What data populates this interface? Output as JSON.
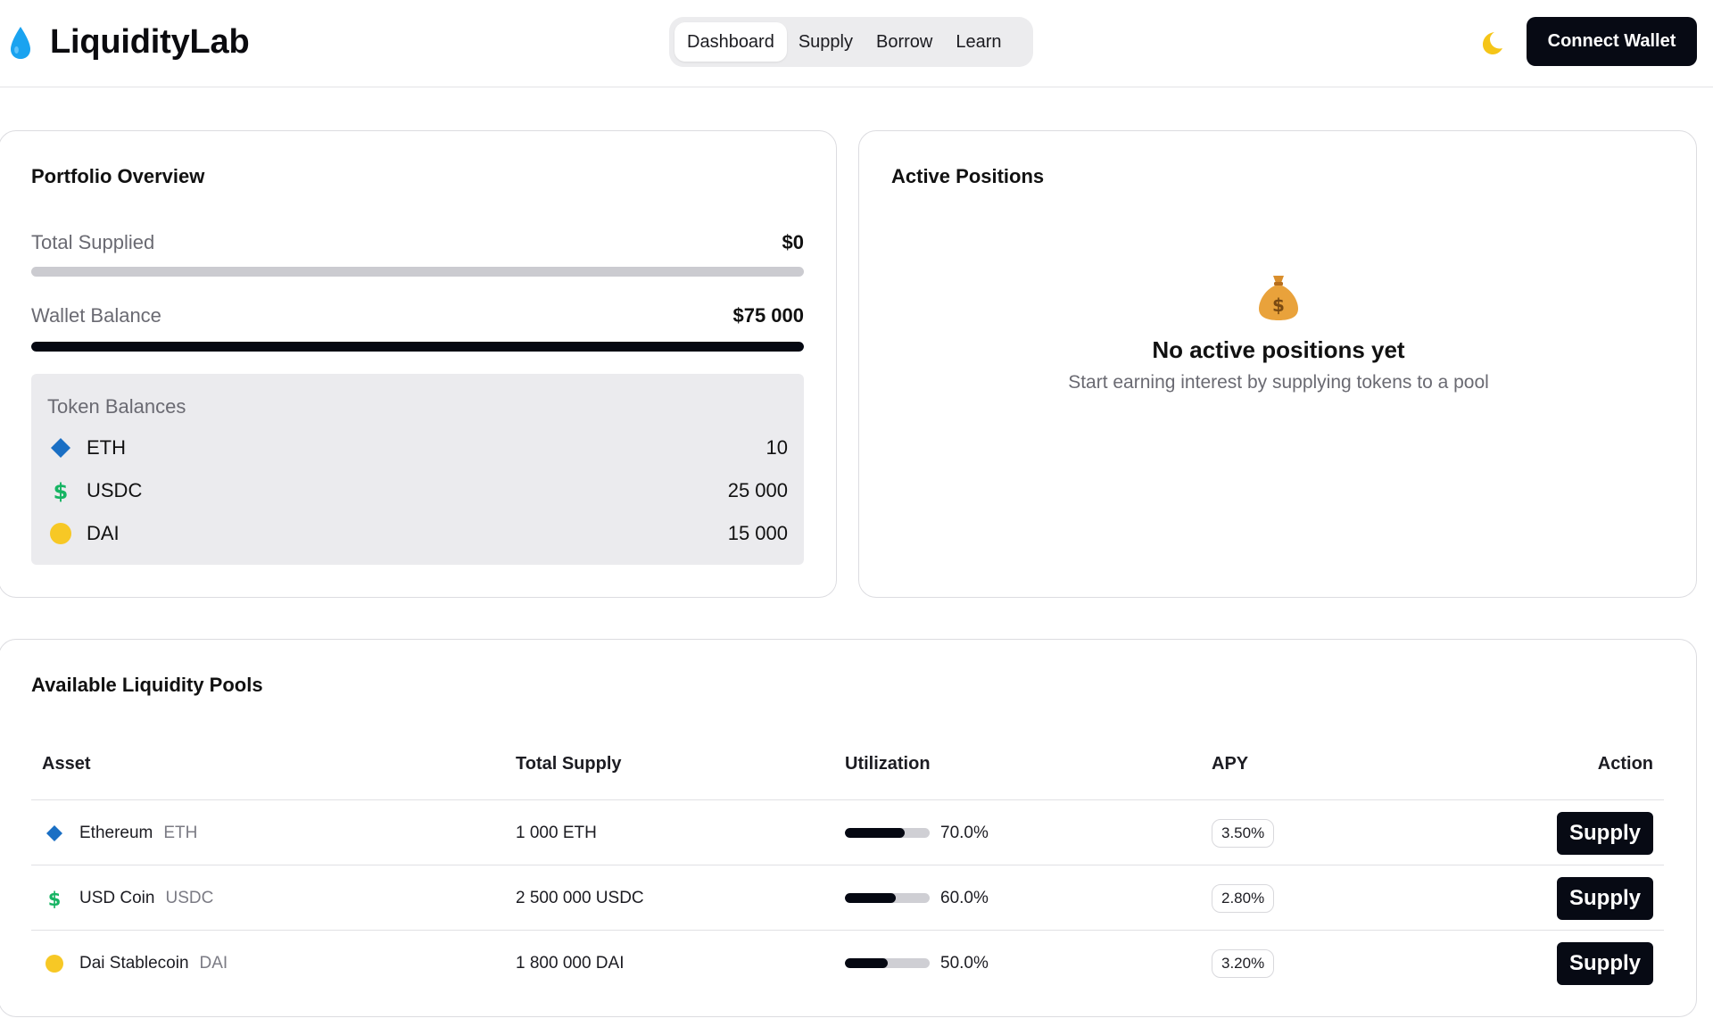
{
  "header": {
    "brand_name": "LiquidityLab",
    "nav": [
      "Dashboard",
      "Supply",
      "Borrow",
      "Learn"
    ],
    "active_tab": "Dashboard",
    "connect_label": "Connect Wallet",
    "theme_icon": "moon-icon"
  },
  "portfolio": {
    "title": "Portfolio Overview",
    "total_supplied_label": "Total Supplied",
    "total_supplied_value": "$0",
    "total_supplied_fraction": 0,
    "wallet_balance_label": "Wallet Balance",
    "wallet_balance_value": "$75 000",
    "wallet_balance_fraction": 1,
    "token_balances_title": "Token Balances",
    "tokens": [
      {
        "symbol": "ETH",
        "amount": "10",
        "icon": "diamond-icon",
        "color": "#1a6fc4"
      },
      {
        "symbol": "USDC",
        "amount": "25 000",
        "icon": "dollar-icon",
        "color": "#16b463"
      },
      {
        "symbol": "DAI",
        "amount": "15 000",
        "icon": "coin-icon",
        "color": "#f7c825"
      }
    ]
  },
  "positions": {
    "title": "Active Positions",
    "empty_icon": "money-bag-icon",
    "empty_title": "No active positions yet",
    "empty_subtitle": "Start earning interest by supplying tokens to a pool"
  },
  "pools": {
    "title": "Available Liquidity Pools",
    "columns": [
      "Asset",
      "Total Supply",
      "Utilization",
      "APY",
      "Action"
    ],
    "rows": [
      {
        "name": "Ethereum",
        "symbol": "ETH",
        "icon": "diamond-icon",
        "color": "#1a6fc4",
        "total_supply": "1 000 ETH",
        "utilization": "70.0%",
        "utilization_value": 0.7,
        "apy": "3.50%",
        "action": "Supply"
      },
      {
        "name": "USD Coin",
        "symbol": "USDC",
        "icon": "dollar-icon",
        "color": "#16b463",
        "total_supply": "2 500 000 USDC",
        "utilization": "60.0%",
        "utilization_value": 0.6,
        "apy": "2.80%",
        "action": "Supply"
      },
      {
        "name": "Dai Stablecoin",
        "symbol": "DAI",
        "icon": "coin-icon",
        "color": "#f7c825",
        "total_supply": "1 800 000 DAI",
        "utilization": "50.0%",
        "utilization_value": 0.5,
        "apy": "3.20%",
        "action": "Supply"
      }
    ]
  },
  "colors": {
    "primary": "#070a14",
    "muted_text": "#6a6a72",
    "border": "#dcdce0",
    "drop_icon": "#1aa3f0",
    "moon_icon": "#f5c518",
    "money_bag": "#e9a23b"
  }
}
